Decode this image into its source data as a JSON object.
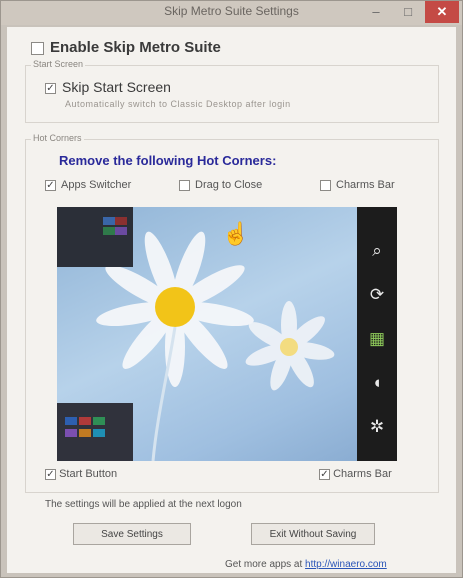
{
  "window": {
    "title": "Skip Metro Suite Settings",
    "min_glyph": "–",
    "max_glyph": "□",
    "close_glyph": "✕"
  },
  "enable": {
    "label": "Enable Skip Metro Suite",
    "checked": false
  },
  "start_screen": {
    "group_label": "Start Screen",
    "skip_label": "Skip Start Screen",
    "skip_checked": true,
    "note": "Automatically switch to Classic Desktop after login"
  },
  "hot_corners": {
    "group_label": "Hot Corners",
    "heading": "Remove the following Hot Corners:",
    "options": {
      "app_switcher": {
        "label": "Apps Switcher",
        "checked": true
      },
      "drag_to_close": {
        "label": "Drag to Close",
        "checked": false
      },
      "charms_bar_top": {
        "label": "Charms Bar",
        "checked": false
      }
    },
    "bottom": {
      "start_button": {
        "label": "Start Button",
        "checked": true
      },
      "charms_bar": {
        "label": "Charms Bar",
        "checked": true
      }
    }
  },
  "note": "The settings will be applied at the next logon",
  "buttons": {
    "save": "Save Settings",
    "exit": "Exit Without Saving"
  },
  "footer": {
    "prefix": "Get more apps at",
    "link": "http://winaero.com"
  },
  "icons": {
    "charms": [
      "search-icon",
      "share-icon",
      "windows-logo-icon",
      "devices-icon",
      "settings-icon"
    ],
    "charm_glyphs": [
      "⌕",
      "⟳",
      "▦",
      "◖",
      "✲"
    ],
    "check_glyph": "✓",
    "pointer": "hand-pointer-icon",
    "pointer_glyph": "☝"
  },
  "colors": {
    "heading_blue": "#2a2a9a",
    "link_blue": "#2a55b8",
    "close_red": "#c44a45",
    "charm_bar": "#1c1c1c",
    "preview_sky": "#a6c4e3"
  }
}
